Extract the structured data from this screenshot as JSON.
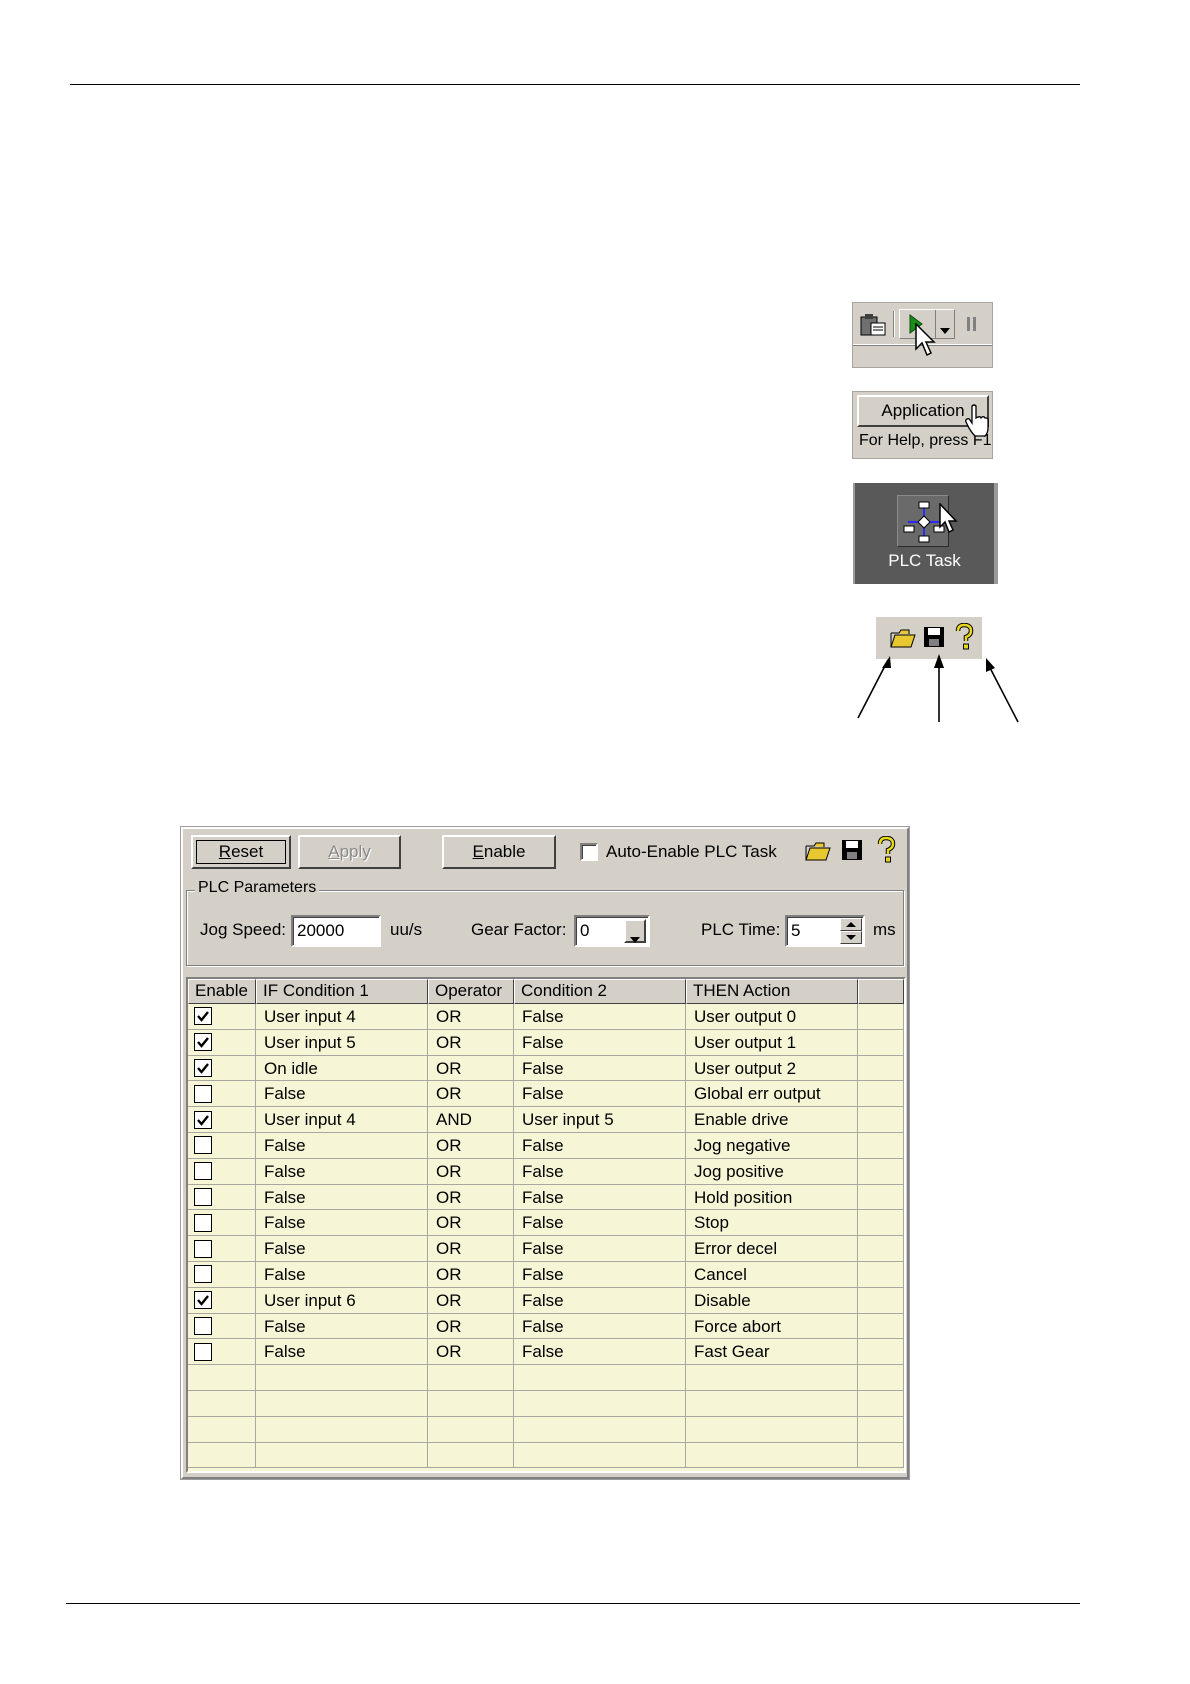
{
  "thumbnails": {
    "application_button": "Application",
    "status_help": "For Help, press F1",
    "plc_task_label": "PLC Task"
  },
  "dialog": {
    "toolbar": {
      "reset": "Reset",
      "apply": "Apply",
      "enable": "Enable",
      "auto_enable_label": "Auto-Enable PLC Task",
      "auto_enable_checked": false
    },
    "params": {
      "legend": "PLC Parameters",
      "jog_speed_label": "Jog Speed:",
      "jog_speed_value": "20000",
      "jog_speed_unit": "uu/s",
      "gear_factor_label": "Gear Factor:",
      "gear_factor_value": "0",
      "plc_time_label": "PLC Time:",
      "plc_time_value": "5",
      "plc_time_unit": "ms"
    },
    "table": {
      "headers": [
        "Enable",
        "IF Condition 1",
        "Operator",
        "Condition 2",
        "THEN Action"
      ],
      "rows": [
        {
          "enabled": true,
          "cond1": "User input 4",
          "op": "OR",
          "cond2": "False",
          "action": "User output 0"
        },
        {
          "enabled": true,
          "cond1": "User input 5",
          "op": "OR",
          "cond2": "False",
          "action": "User output 1"
        },
        {
          "enabled": true,
          "cond1": "On idle",
          "op": "OR",
          "cond2": "False",
          "action": "User output 2"
        },
        {
          "enabled": false,
          "cond1": "False",
          "op": "OR",
          "cond2": "False",
          "action": "Global err output"
        },
        {
          "enabled": true,
          "cond1": "User input 4",
          "op": "AND",
          "cond2": "User input 5",
          "action": "Enable drive"
        },
        {
          "enabled": false,
          "cond1": "False",
          "op": "OR",
          "cond2": "False",
          "action": "Jog negative"
        },
        {
          "enabled": false,
          "cond1": "False",
          "op": "OR",
          "cond2": "False",
          "action": "Jog positive"
        },
        {
          "enabled": false,
          "cond1": "False",
          "op": "OR",
          "cond2": "False",
          "action": "Hold position"
        },
        {
          "enabled": false,
          "cond1": "False",
          "op": "OR",
          "cond2": "False",
          "action": "Stop"
        },
        {
          "enabled": false,
          "cond1": "False",
          "op": "OR",
          "cond2": "False",
          "action": "Error decel"
        },
        {
          "enabled": false,
          "cond1": "False",
          "op": "OR",
          "cond2": "False",
          "action": "Cancel"
        },
        {
          "enabled": true,
          "cond1": "User input 6",
          "op": "OR",
          "cond2": "False",
          "action": "Disable"
        },
        {
          "enabled": false,
          "cond1": "False",
          "op": "OR",
          "cond2": "False",
          "action": "Force abort"
        },
        {
          "enabled": false,
          "cond1": "False",
          "op": "OR",
          "cond2": "False",
          "action": "Fast Gear"
        }
      ]
    }
  },
  "icons": [
    "clipboard-icon",
    "play-icon",
    "dropdown-arrow-icon",
    "pause-icon",
    "hand-cursor-icon",
    "arrow-cursor-icon",
    "plc-task-icon",
    "open-folder-icon",
    "save-disk-icon",
    "help-icon",
    "checkmark-icon"
  ],
  "colors": {
    "window_face": "#d4d0c8",
    "grid_background": "#f6f5d6",
    "play_green": "#1a8c1a",
    "help_yellow": "#e8d81a",
    "plc_panel": "#595959"
  }
}
